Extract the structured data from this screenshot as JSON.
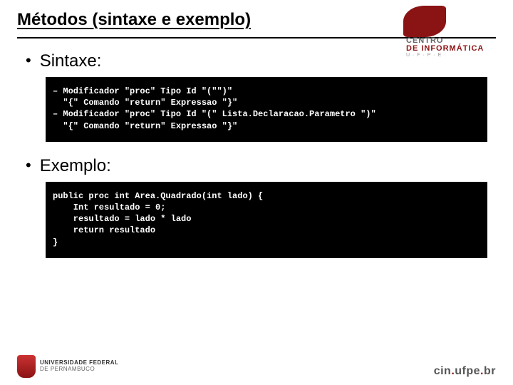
{
  "title": "Métodos (sintaxe e exemplo)",
  "logo_top": {
    "line1": "CENTRO",
    "line2": "DE INFORMÁTICA",
    "line3": "U · F · P · E"
  },
  "section1": {
    "label": "Sintaxe:",
    "code": "– Modificador \"proc\" Tipo Id \"(\"\")\"\n  \"{\" Comando \"return\" Expressao \"}\"\n– Modificador \"proc\" Tipo Id \"(\" Lista.Declaracao.Parametro \")\"\n  \"{\" Comando \"return\" Expressao \"}\""
  },
  "section2": {
    "label": "Exemplo:",
    "code": "public proc int Area.Quadrado(int lado) {\n    Int resultado = 0;\n    resultado = lado * lado\n    return resultado\n}"
  },
  "footer": {
    "ufpe_line1": "UNIVERSIDADE FEDERAL",
    "ufpe_line2": "DE PERNAMBUCO",
    "cin": "cin.ufpe.br"
  }
}
